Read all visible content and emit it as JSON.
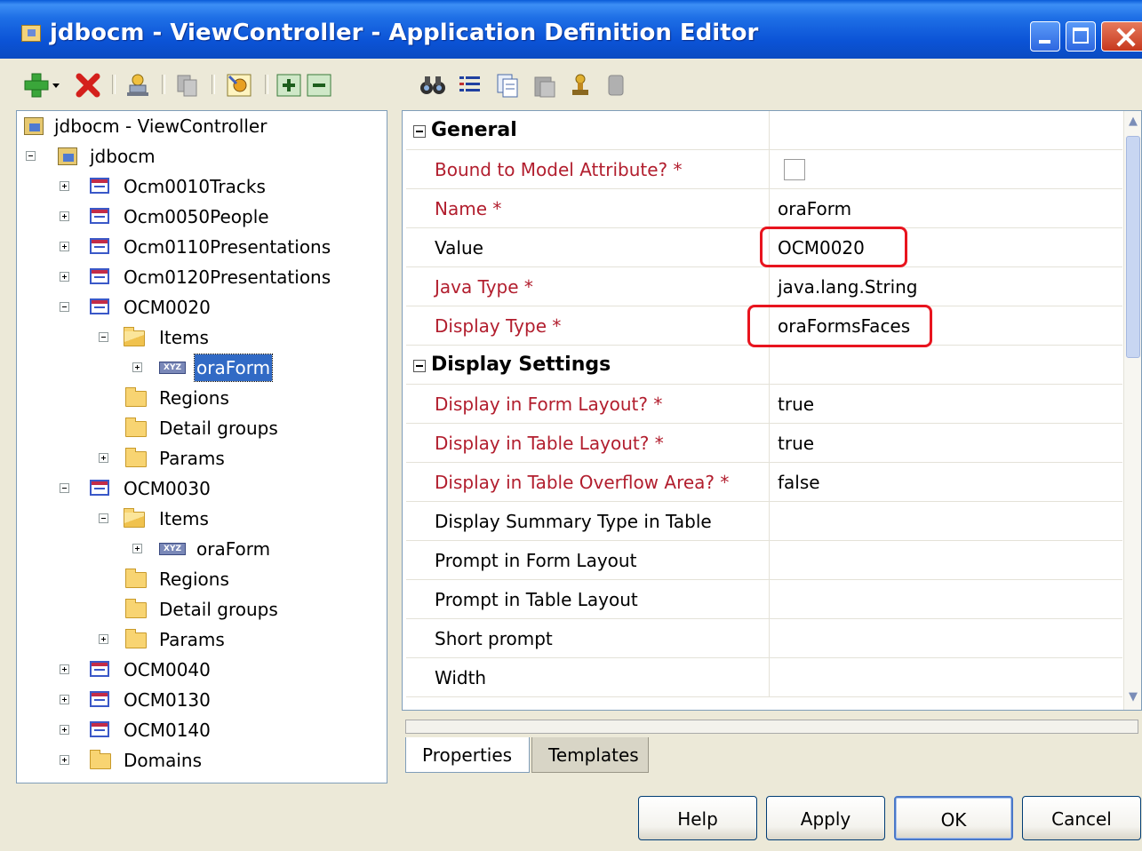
{
  "window": {
    "title": "jdbocm - ViewController - Application Definition Editor"
  },
  "tree": {
    "nodes": [
      {
        "label": "jdbocm - ViewController",
        "icon": "project-icon"
      },
      {
        "label": "jdbocm",
        "icon": "project-folder-icon"
      },
      {
        "label": "Ocm0010Tracks",
        "icon": "table-icon"
      },
      {
        "label": "Ocm0050People",
        "icon": "table-icon"
      },
      {
        "label": "Ocm0110Presentations",
        "icon": "table-icon"
      },
      {
        "label": "Ocm0120Presentations",
        "icon": "table-icon"
      },
      {
        "label": "OCM0020",
        "icon": "table-icon"
      },
      {
        "label": "Items",
        "icon": "folder-open-icon"
      },
      {
        "label": "oraForm",
        "icon": "xyz-item-icon",
        "selected": true
      },
      {
        "label": "Regions",
        "icon": "folder-icon"
      },
      {
        "label": "Detail groups",
        "icon": "folder-icon"
      },
      {
        "label": "Params",
        "icon": "folder-icon"
      },
      {
        "label": "OCM0030",
        "icon": "table-icon"
      },
      {
        "label": "Items",
        "icon": "folder-open-icon"
      },
      {
        "label": "oraForm",
        "icon": "xyz-item-icon"
      },
      {
        "label": "Regions",
        "icon": "folder-icon"
      },
      {
        "label": "Detail groups",
        "icon": "folder-icon"
      },
      {
        "label": "Params",
        "icon": "folder-icon"
      },
      {
        "label": "OCM0040",
        "icon": "table-icon"
      },
      {
        "label": "OCM0130",
        "icon": "table-icon"
      },
      {
        "label": "OCM0140",
        "icon": "table-icon"
      },
      {
        "label": "Domains",
        "icon": "folder-icon"
      }
    ],
    "xyz_badge": "XYZ"
  },
  "properties": {
    "general_header": "General",
    "display_header": "Display Settings",
    "general": [
      {
        "name": "Bound to Model Attribute? *",
        "value": "",
        "required": true,
        "checkbox": true
      },
      {
        "name": "Name *",
        "value": "oraForm",
        "required": true
      },
      {
        "name": "Value",
        "value": "OCM0020",
        "required": false
      },
      {
        "name": "Java Type *",
        "value": "java.lang.String",
        "required": true
      },
      {
        "name": "Display Type *",
        "value": "oraFormsFaces",
        "required": true
      }
    ],
    "display": [
      {
        "name": "Display in Form Layout? *",
        "value": "true",
        "required": true
      },
      {
        "name": "Display in Table Layout? *",
        "value": "true",
        "required": true
      },
      {
        "name": "Display in Table Overflow Area? *",
        "value": "false",
        "required": true
      },
      {
        "name": "Display Summary Type in Table",
        "value": "",
        "required": false
      },
      {
        "name": "Prompt in Form Layout",
        "value": "",
        "required": false
      },
      {
        "name": "Prompt in Table Layout",
        "value": "",
        "required": false
      },
      {
        "name": "Short prompt",
        "value": "",
        "required": false
      },
      {
        "name": "Width",
        "value": "",
        "required": false
      }
    ]
  },
  "tabs": {
    "properties": "Properties",
    "templates": "Templates"
  },
  "buttons": {
    "help": "Help",
    "apply": "Apply",
    "ok": "OK",
    "cancel": "Cancel"
  },
  "colors": {
    "required_text": "#b21e2e",
    "callout": "#e8141e",
    "selection": "#316ac5",
    "titlebar": "#0b53d6"
  }
}
